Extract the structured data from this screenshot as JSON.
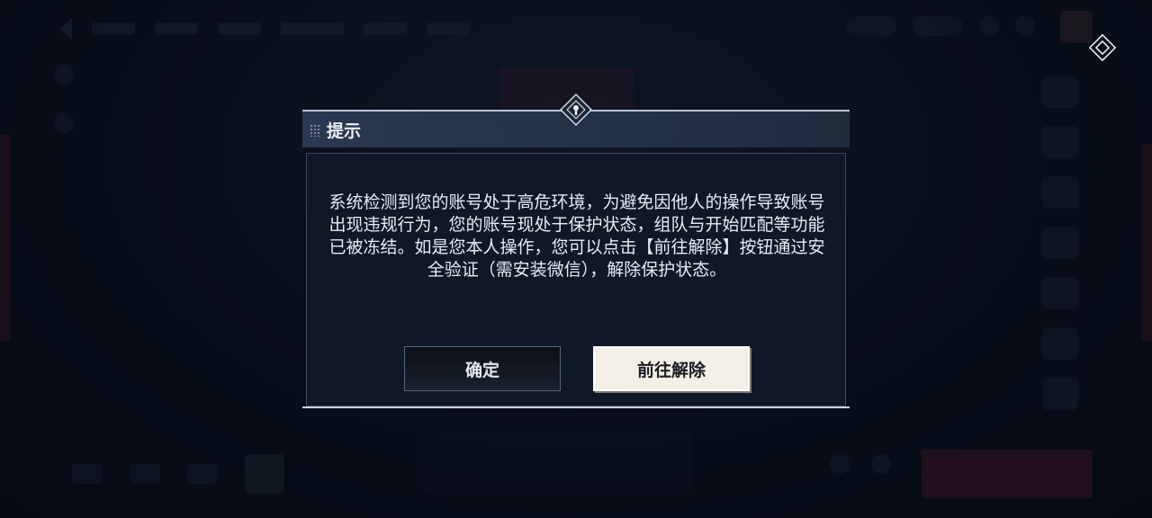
{
  "dialog": {
    "title": "提示",
    "message": "系统检测到您的账号处于高危环境，为避免因他人的操作导致账号出现违规行为，您的账号现处于保护状态，组队与开始匹配等功能已被冻结。如是您本人操作，您可以点击【前往解除】按钮通过安全验证（需安装微信），解除保护状态。",
    "confirm_label": "确定",
    "unlock_label": "前往解除"
  },
  "icons": {
    "corner": "diamond-icon",
    "header_emblem": "emblem-icon",
    "grip": "grip-dots-icon"
  },
  "colors": {
    "accent_light": "#f4efe6",
    "dialog_bg": "#0f1827",
    "header_bg": "#2b3950"
  }
}
